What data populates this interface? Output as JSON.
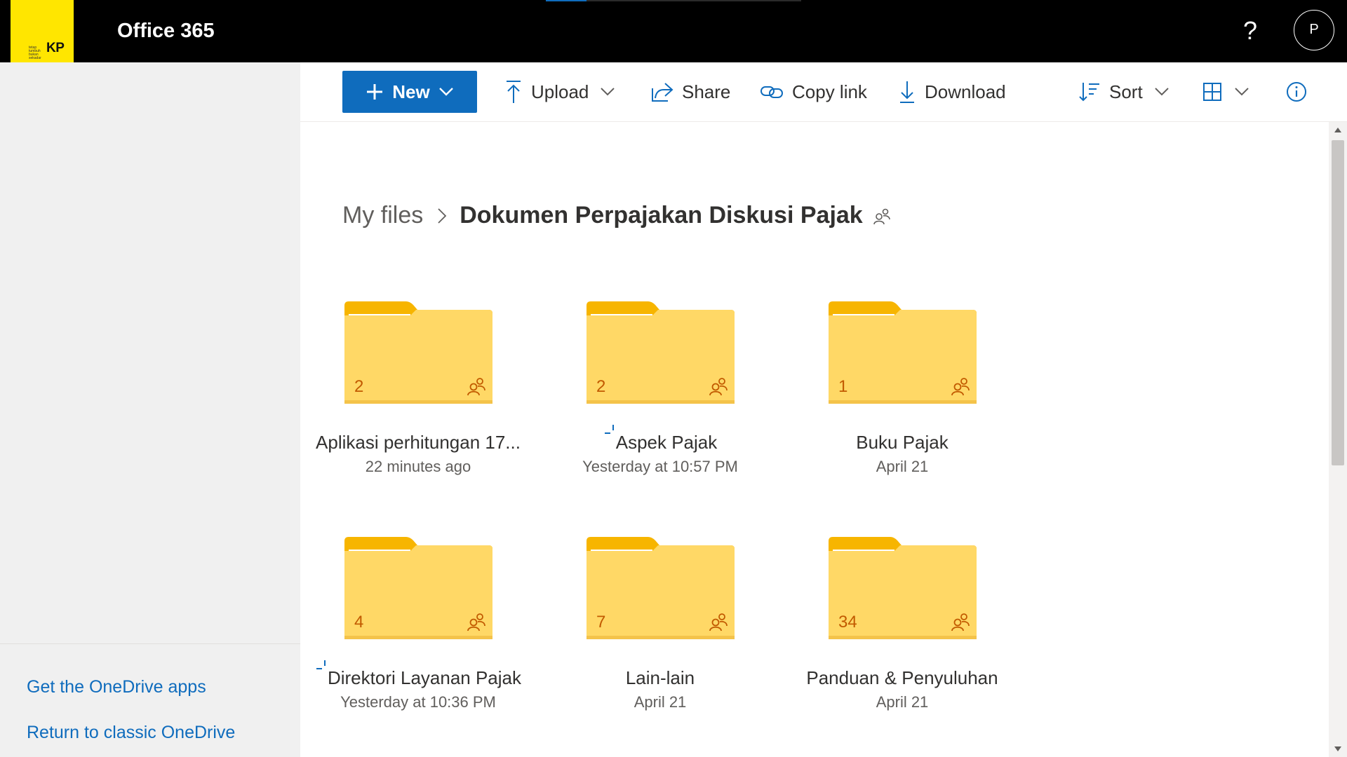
{
  "header": {
    "app_title": "Office 365",
    "logo_text": "KP",
    "logo_tagline": "tetap tumbuh bukan sekadar",
    "avatar_initial": "P",
    "help_label": "?",
    "loading_progress": 0.16
  },
  "toolbar": {
    "new_label": "New",
    "upload_label": "Upload",
    "share_label": "Share",
    "copy_link_label": "Copy link",
    "download_label": "Download",
    "sort_label": "Sort"
  },
  "breadcrumb": {
    "root": "My files",
    "current": "Dokumen Perpajakan Diskusi Pajak"
  },
  "folders": [
    {
      "name": "Aplikasi perhitungan 17...",
      "modified": "22 minutes ago",
      "count": "2",
      "shared": true,
      "syncing": false
    },
    {
      "name": "Aspek Pajak",
      "modified": "Yesterday at 10:57 PM",
      "count": "2",
      "shared": true,
      "syncing": true
    },
    {
      "name": "Buku Pajak",
      "modified": "April 21",
      "count": "1",
      "shared": true,
      "syncing": false
    },
    {
      "name": "Direktori Layanan Pajak",
      "modified": "Yesterday at 10:36 PM",
      "count": "4",
      "shared": true,
      "syncing": true
    },
    {
      "name": "Lain-lain",
      "modified": "April 21",
      "count": "7",
      "shared": true,
      "syncing": false
    },
    {
      "name": "Panduan & Penyuluhan",
      "modified": "April 21",
      "count": "34",
      "shared": true,
      "syncing": false
    }
  ],
  "leftnav": {
    "get_apps": "Get the OneDrive apps",
    "classic": "Return to classic OneDrive"
  },
  "colors": {
    "accent": "#0f6cbd",
    "topbar": "#000000",
    "logo": "#ffe600",
    "folder_body": "#ffd866",
    "folder_tab": "#f7b500",
    "folder_count": "#c25a00"
  }
}
